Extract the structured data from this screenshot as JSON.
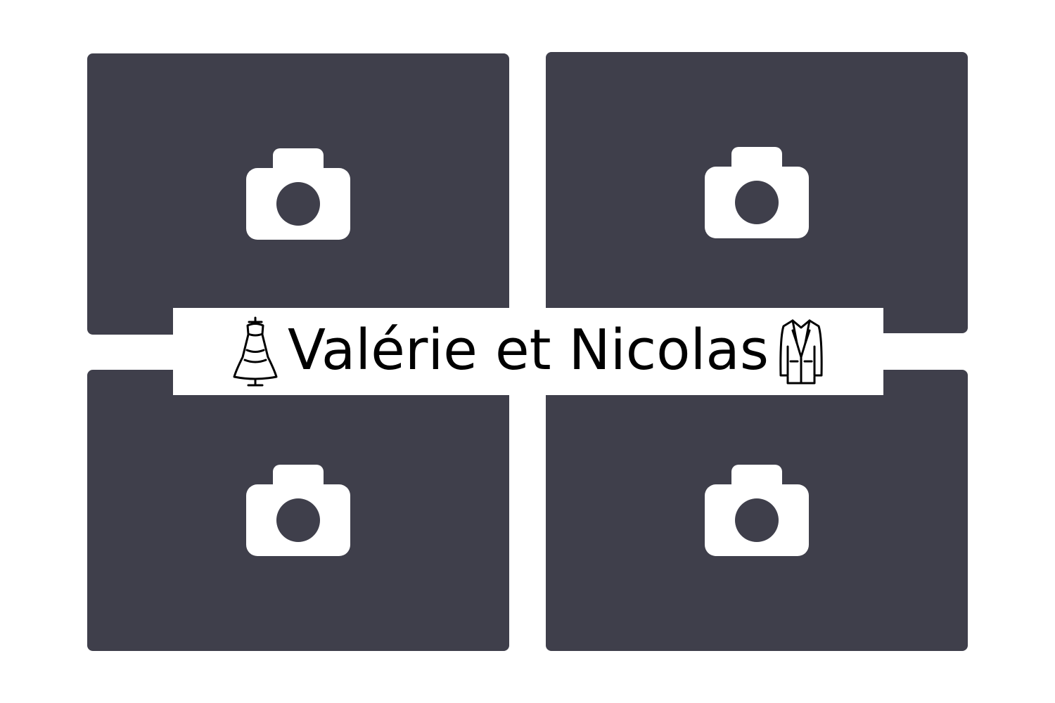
{
  "colors": {
    "background": "#ffffff",
    "photo_slot": "#3f3f4b",
    "icon": "#ffffff",
    "title_text": "#000000"
  },
  "photo_slots": [
    {
      "icon": "camera-icon"
    },
    {
      "icon": "camera-icon"
    },
    {
      "icon": "camera-icon"
    },
    {
      "icon": "camera-icon"
    }
  ],
  "banner": {
    "title": "Valérie et Nicolas",
    "left_icon": "wedding-dress-icon",
    "right_icon": "suit-jacket-icon"
  }
}
